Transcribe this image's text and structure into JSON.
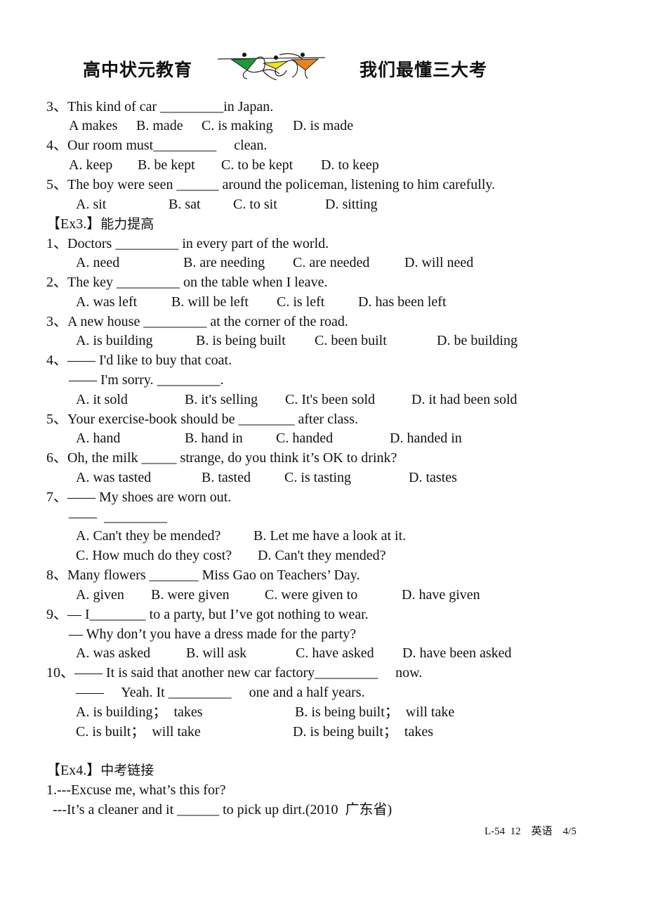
{
  "header": {
    "left_title": "高中状元教育",
    "right_title": "我们最懂三大考",
    "logo_icon": "three-figures-logo",
    "logo_colors": [
      "#1a9a3a",
      "#f2e01a",
      "#e8821e"
    ]
  },
  "part1": {
    "questions": [
      {
        "num": "3、",
        "text": "This kind of car _________in Japan.",
        "options": [
          "A makes",
          "B. made",
          "C. is making",
          "D. is made"
        ]
      },
      {
        "num": "4、",
        "text": "Our room must_________     clean.",
        "options": [
          "A. keep",
          "B. be kept",
          "C. to be kept",
          "D. to keep"
        ]
      },
      {
        "num": "5、",
        "text": "The boy were seen ______ around the policeman, listening to him carefully.",
        "options": [
          "A. sit",
          "B. sat",
          "C. to sit",
          "D. sitting"
        ]
      }
    ]
  },
  "ex3": {
    "title_prefix": "【Ex3.】",
    "title_cjk": "能力提高",
    "questions": [
      {
        "num": "1、",
        "text": "Doctors _________ in every part of the world.",
        "options": [
          "A. need",
          "B. are needing",
          "C. are needed",
          "D. will need"
        ]
      },
      {
        "num": "2、",
        "text": "The key _________ on the table when I leave.",
        "options": [
          "A. was left",
          "B. will be left",
          "C. is left",
          "D. has been left"
        ]
      },
      {
        "num": "3、",
        "text": "A new house _________ at the corner of the road.",
        "options": [
          "A. is building",
          "B. is being built",
          "C. been built",
          "D. be building"
        ]
      },
      {
        "num": "4、",
        "text": "—— I'd like to buy that coat.",
        "text2": "—— I'm sorry. _________.",
        "options": [
          "A. it sold",
          "B. it's selling",
          "C. It's been sold",
          "D. it had been sold"
        ]
      },
      {
        "num": "5、",
        "text": "Your exercise-book should be ________ after class.",
        "options": [
          "A. hand",
          "B. hand in",
          "C. handed",
          "D. handed in"
        ]
      },
      {
        "num": "6、",
        "text": "Oh, the milk _____ strange, do you think it’s OK to drink?",
        "options": [
          "A. was tasted",
          "B. tasted",
          "C. is tasting",
          "D. tastes"
        ]
      },
      {
        "num": "7、",
        "text": "—— My shoes are worn out.",
        "text2": "——  _________",
        "options": [
          "A. Can't they be mended?",
          "B. Let me have a look at it.",
          "C. How much do they cost?",
          "D. Can't they mended?"
        ]
      },
      {
        "num": "8、",
        "text": "Many flowers _______ Miss Gao on Teachers’ Day.",
        "options": [
          "A. given",
          "B. were given",
          "C. were given to",
          "D. have given"
        ]
      },
      {
        "num": "9、",
        "text": "— I________ to a party, but I’ve got nothing to wear.",
        "text2": "— Why don’t you have a dress made for the party?",
        "options": [
          "A. was asked",
          "B. will ask",
          "C. have asked",
          "D. have been asked"
        ]
      },
      {
        "num": "10、",
        "text": "—— It is said that another new car factory_________     now.",
        "text2": "——     Yeah. It _________     one and a half years.",
        "options": [
          "A. is building；  takes",
          "B. is being built；  will take",
          "C. is built；  will take",
          "D. is being built；  takes"
        ]
      }
    ]
  },
  "ex4": {
    "title_prefix": "【Ex4.】",
    "title_cjk": "中考链接",
    "questions": [
      {
        "line1": "1.---Excuse me, what’s this for?",
        "line2": " ---It’s a cleaner and it ______ to pick up dirt.(2010  广东省)"
      }
    ]
  },
  "footer": {
    "text": "L-54  12    英语    4/5"
  }
}
